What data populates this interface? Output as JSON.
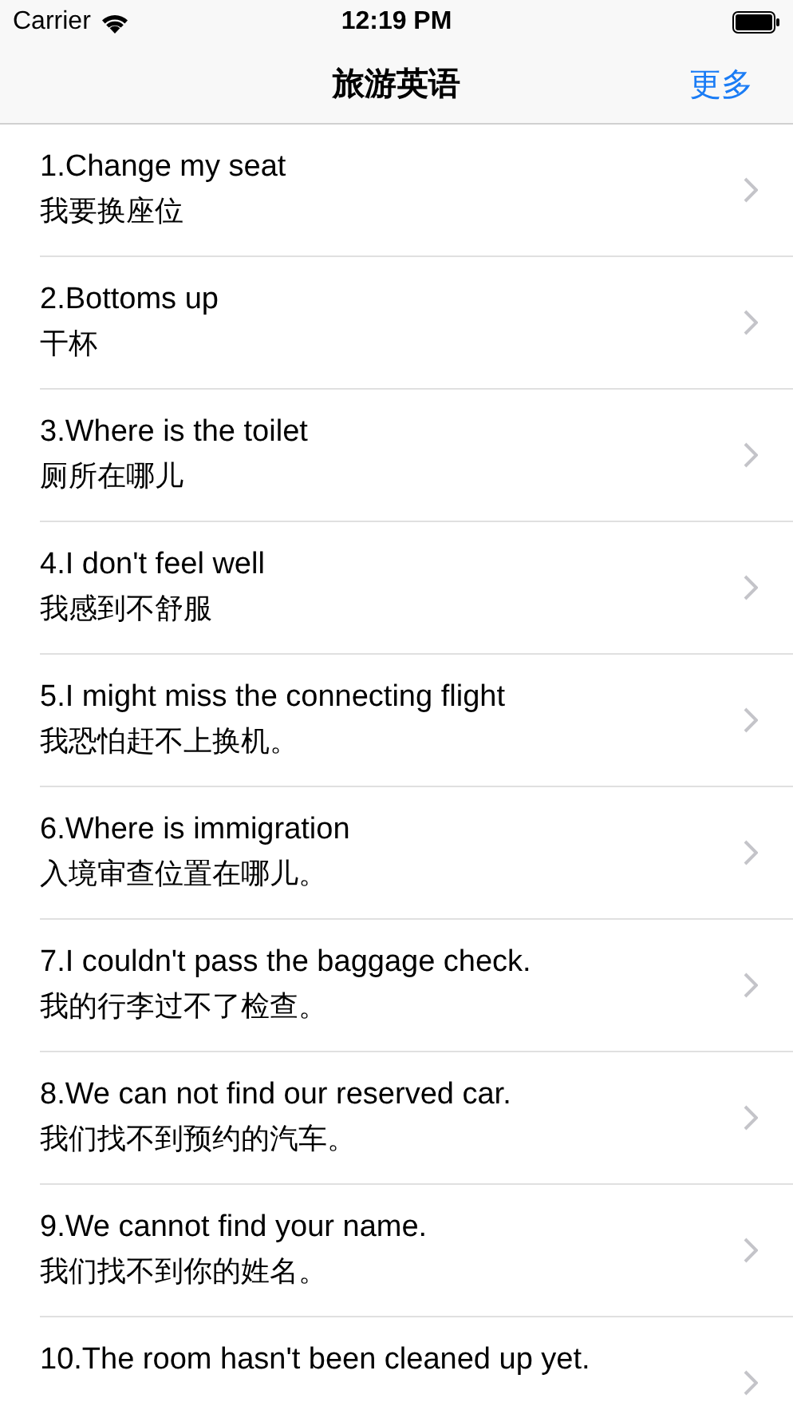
{
  "status_bar": {
    "carrier": "Carrier",
    "time": "12:19 PM"
  },
  "nav": {
    "title": "旅游英语",
    "more_button": "更多"
  },
  "rows": [
    {
      "title": "1.Change my seat",
      "subtitle": "我要换座位"
    },
    {
      "title": "2.Bottoms up",
      "subtitle": "干杯"
    },
    {
      "title": "3.Where is the toilet",
      "subtitle": "厕所在哪儿"
    },
    {
      "title": "4.I don't feel well",
      "subtitle": "我感到不舒服"
    },
    {
      "title": "5.I might miss the connecting flight",
      "subtitle": "我恐怕赶不上换机。"
    },
    {
      "title": "6.Where is immigration",
      "subtitle": "入境审查位置在哪儿。"
    },
    {
      "title": "7.I couldn't pass the baggage check.",
      "subtitle": "我的行李过不了检查。"
    },
    {
      "title": "8.We can not find our reserved car.",
      "subtitle": "我们找不到预约的汽车。"
    },
    {
      "title": "9.We cannot find your name.",
      "subtitle": "我们找不到你的姓名。"
    },
    {
      "title": "10.The room hasn't been cleaned up yet."
    }
  ]
}
